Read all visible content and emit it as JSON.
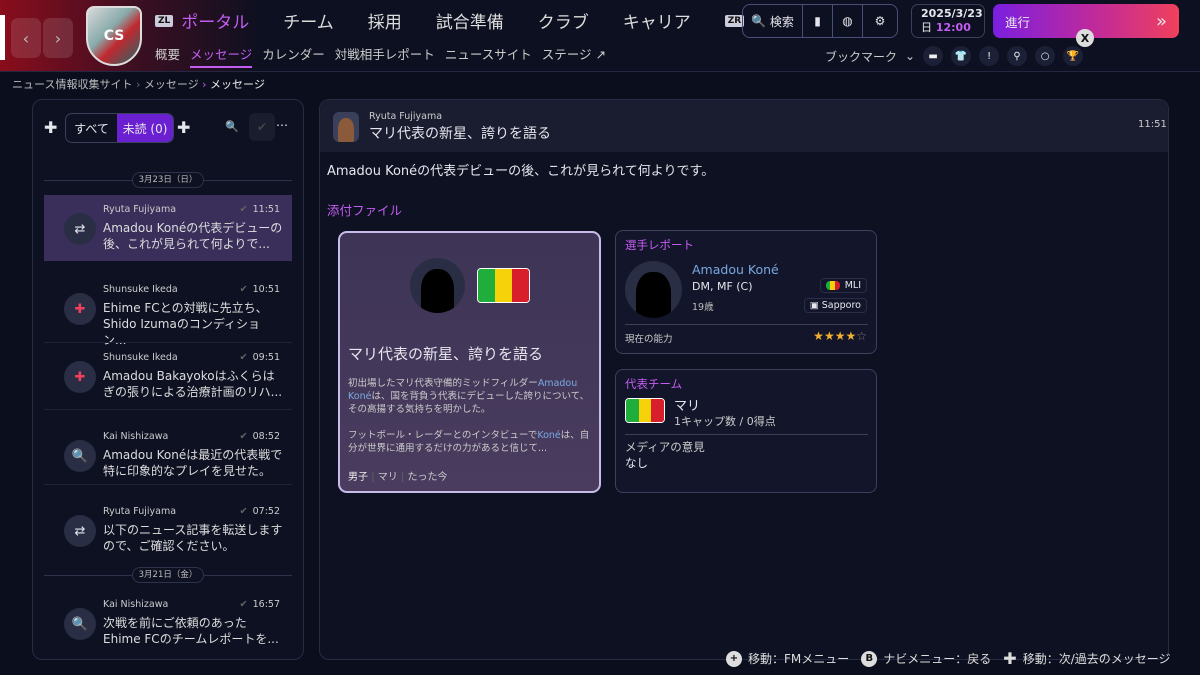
{
  "nav": {
    "main": [
      "ポータル",
      "チーム",
      "採用",
      "試合準備",
      "クラブ",
      "キャリア"
    ],
    "zl": "ZL",
    "zr": "ZR",
    "crest": "CS",
    "sub": [
      "概要",
      "メッセージ",
      "カレンダー",
      "対戦相手レポート",
      "ニュースサイト",
      "ステージ"
    ],
    "search": "検索",
    "date": "2025/3/23",
    "day": "日",
    "time": "12:00",
    "proceed": "進行",
    "x_key": "X",
    "bookmark": "ブックマーク"
  },
  "breadcrumb": [
    "ニュース情報収集サイト",
    "メッセージ",
    "メッセージ"
  ],
  "inbox": {
    "filter_all": "すべて",
    "filter_unread": "未読 (0)",
    "date1": "3月23日（日）",
    "date2": "3月21日（金）",
    "messages": [
      {
        "from": "Ryuta Fujiyama",
        "time": "11:51",
        "body": "Amadou Konéの代表デビューの後、これが見られて何よりで..."
      },
      {
        "from": "Shunsuke Ikeda",
        "time": "10:51",
        "body": "Ehime FCとの対戦に先立ち、Shido Izumaのコンディション..."
      },
      {
        "from": "Shunsuke Ikeda",
        "time": "09:51",
        "body": "Amadou Bakayokoはふくらはぎの張りによる治療計画のリハ..."
      },
      {
        "from": "Kai Nishizawa",
        "time": "08:52",
        "body": "Amadou Konéは最近の代表戦で特に印象的なプレイを見せた。"
      },
      {
        "from": "Ryuta Fujiyama",
        "time": "07:52",
        "body": "以下のニュース記事を転送しますので、ご確認ください。"
      },
      {
        "from": "Kai Nishizawa",
        "time": "16:57",
        "body": "次戦を前にご依頼のあったEhime FCのチームレポートを..."
      }
    ]
  },
  "message": {
    "from": "Ryuta Fujiyama",
    "subject": "マリ代表の新星、誇りを語る",
    "time": "11:51",
    "body": "Amadou Konéの代表デビューの後、これが見られて何よりです。",
    "attachments_label": "添付ファイル",
    "news": {
      "title": "マリ代表の新星、誇りを語る",
      "p1a": "初出場したマリ代表守備的ミッドフィルダー",
      "p1link": "Amadou Koné",
      "p1b": "は、国を背負う代表にデビューした誇りについて、その高揚する気持ちを明かした。",
      "p2a": "フットボール・レーダーとのインタビューで",
      "p2link": "Koné",
      "p2b": "は、自分が世界に通用するだけの力があると信じて...",
      "tags": [
        "男子",
        "マリ",
        "たった今"
      ]
    },
    "player": {
      "label": "選手レポート",
      "name": "Amadou Koné",
      "pos": "DM, MF (C)",
      "age": "19歳",
      "nation": "MLI",
      "club": "Sapporo",
      "ability_label": "現在の能力",
      "stars": 4,
      "stars_max": 5
    },
    "national": {
      "label": "代表チーム",
      "country": "マリ",
      "caps": "1キャップ数 / 0得点",
      "media_label": "メディアの意見",
      "media": "なし"
    }
  },
  "footer": {
    "k1": "移動：FMメニュー",
    "k2key": "B",
    "k2": "ナビメニュー：戻る",
    "k3": "移動：次/過去のメッセージ"
  },
  "colors": {
    "accent": "#c35cf2",
    "mali_green": "#1fae3c",
    "mali_yellow": "#f5d20a",
    "mali_red": "#d81e2a"
  }
}
